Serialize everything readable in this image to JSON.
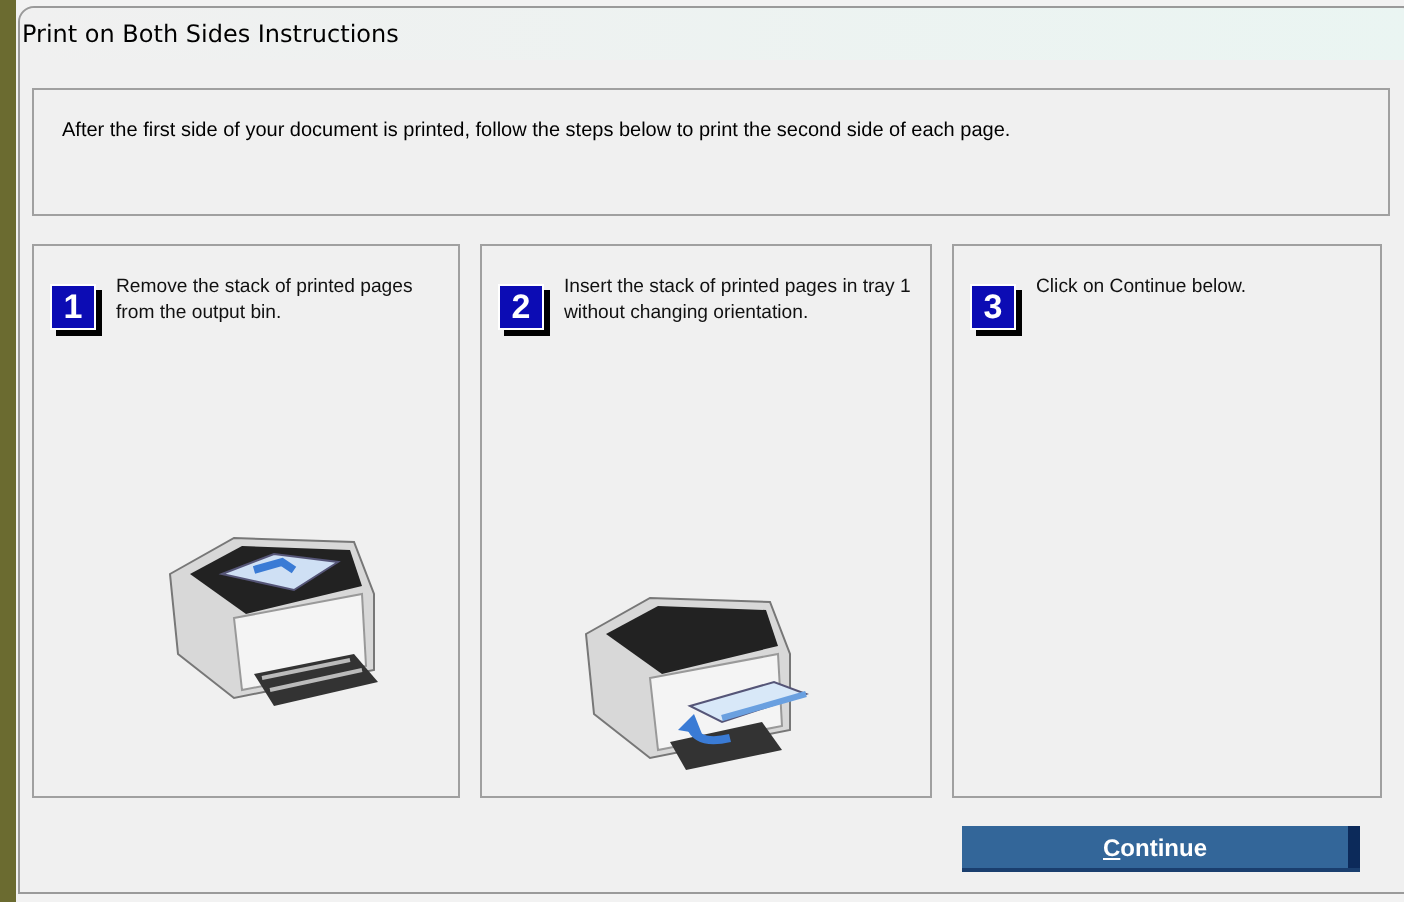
{
  "window": {
    "title": "Print on Both Sides Instructions"
  },
  "intro": "After the first side of your document is printed, follow the steps below to print the second side of each page.",
  "steps": [
    {
      "number": "1",
      "text": "Remove the stack of printed pages from the output bin.",
      "kind": "remove"
    },
    {
      "number": "2",
      "text": "Insert the stack of printed pages in tray 1 without changing orientation.",
      "kind": "insert"
    },
    {
      "number": "3",
      "text": "Click on Continue below.",
      "kind": "plain"
    }
  ],
  "button": {
    "label": "Continue"
  }
}
